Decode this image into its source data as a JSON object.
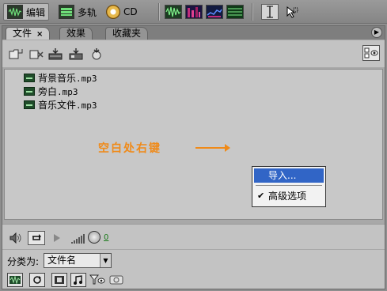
{
  "topbar": {
    "modes": [
      {
        "label": "编辑",
        "icon": "waveform-edit-icon"
      },
      {
        "label": "多轨",
        "icon": "multitrack-icon"
      },
      {
        "label": "CD",
        "icon": "cd-icon"
      }
    ],
    "workspace_buttons": [
      "waveform-view-icon",
      "spectral-view-icon",
      "spectral-pitch-icon",
      "frequency-view-icon"
    ],
    "tools": [
      "time-selection-tool-icon",
      "marquee-tool-icon"
    ]
  },
  "panel": {
    "tabs": [
      {
        "label": "文件",
        "close": "×"
      },
      {
        "label": "效果"
      },
      {
        "label": "收藏夹"
      }
    ],
    "toolbar_icons": [
      "import-file-icon",
      "close-file-icon",
      "insert-multitrack-icon",
      "insert-cd-icon",
      "edit-file-icon"
    ],
    "options_icon": "show-options-icon"
  },
  "files": [
    {
      "name": "背景音乐",
      "ext": ".mp3"
    },
    {
      "name": "旁白",
      "ext": ".mp3"
    },
    {
      "name": "音乐文件",
      "ext": ".mp3"
    }
  ],
  "annotation": {
    "text": "空白处右键",
    "color": "#f08a18"
  },
  "context_menu": {
    "items": [
      {
        "label": "导入...",
        "selected": true,
        "checked": false
      },
      {
        "label": "高级选项",
        "selected": false,
        "checked": true
      }
    ],
    "highlight_color": "#3165c6"
  },
  "transport": {
    "volume_value": "0"
  },
  "sort": {
    "label": "分类为:",
    "selected": "文件名"
  },
  "bottom_icons": [
    "waveform-filter-icon",
    "loop-filter-icon",
    "video-filter-icon",
    "midi-filter-icon",
    "filter-options-icon",
    "cd-filter-icon"
  ]
}
